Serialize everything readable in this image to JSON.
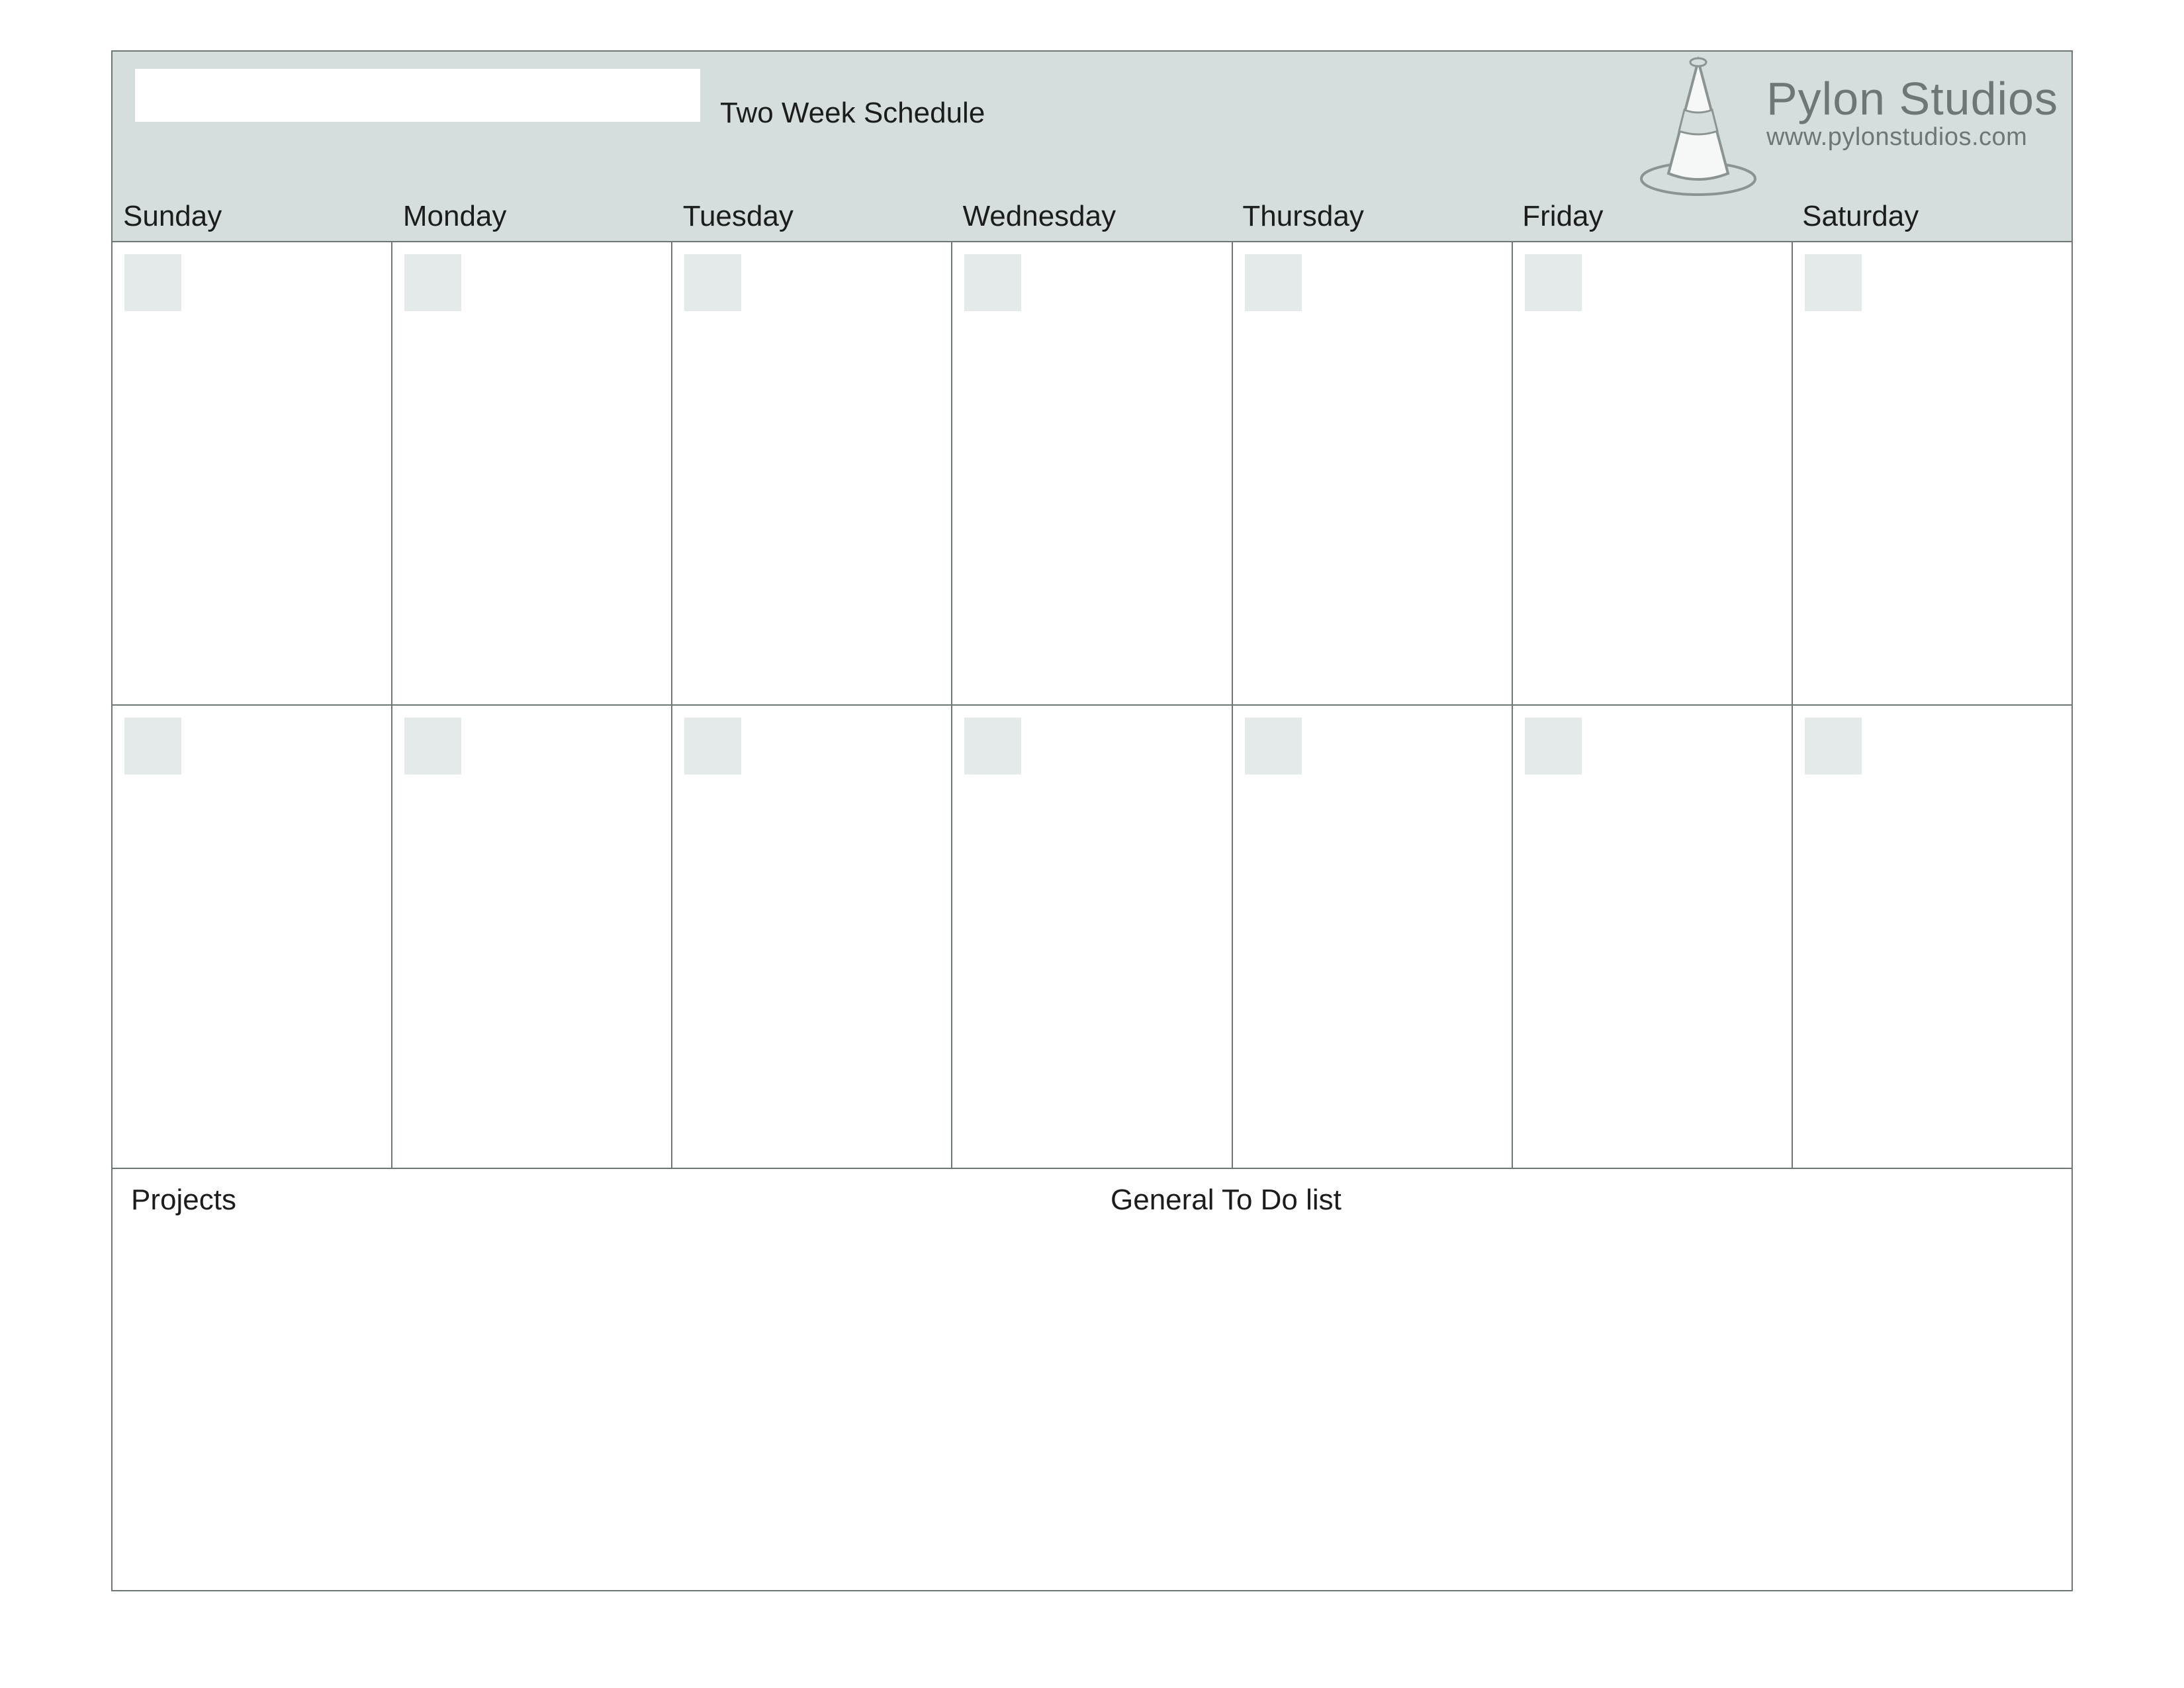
{
  "header": {
    "title_value": "",
    "title_label": "Two Week Schedule"
  },
  "days": [
    "Sunday",
    "Monday",
    "Tuesday",
    "Wednesday",
    "Thursday",
    "Friday",
    "Saturday"
  ],
  "brand": {
    "name": "Pylon Studios",
    "url": "www.pylonstudios.com"
  },
  "cells": [
    {
      "date": ""
    },
    {
      "date": ""
    },
    {
      "date": ""
    },
    {
      "date": ""
    },
    {
      "date": ""
    },
    {
      "date": ""
    },
    {
      "date": ""
    },
    {
      "date": ""
    },
    {
      "date": ""
    },
    {
      "date": ""
    },
    {
      "date": ""
    },
    {
      "date": ""
    },
    {
      "date": ""
    },
    {
      "date": ""
    }
  ],
  "footer": {
    "projects_label": "Projects",
    "todo_label": "General To Do list"
  }
}
